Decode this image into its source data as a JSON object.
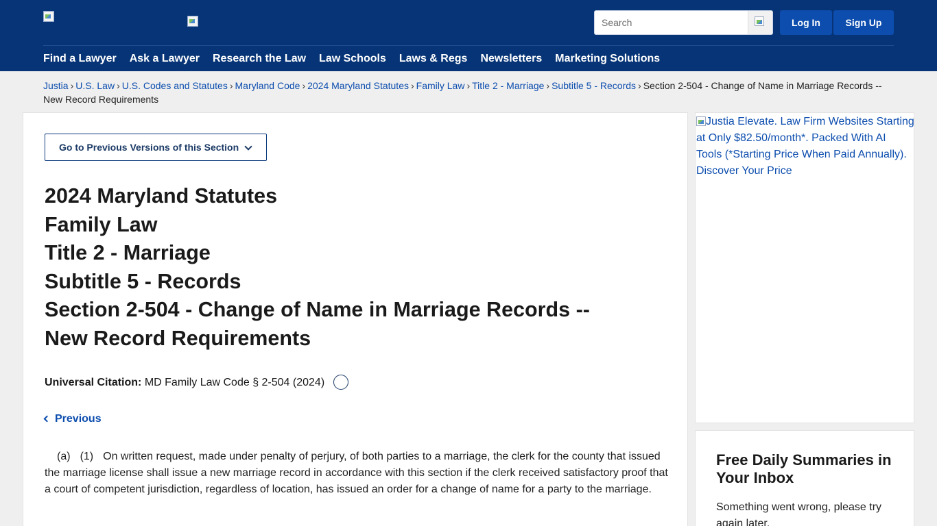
{
  "header": {
    "search_placeholder": "Search",
    "login_label": "Log In",
    "signup_label": "Sign Up",
    "nav": [
      "Find a Lawyer",
      "Ask a Lawyer",
      "Research the Law",
      "Law Schools",
      "Laws & Regs",
      "Newsletters",
      "Marketing Solutions"
    ]
  },
  "breadcrumb": {
    "links": [
      "Justia",
      "U.S. Law",
      "U.S. Codes and Statutes",
      "Maryland Code",
      "2024 Maryland Statutes",
      "Family Law",
      "Title 2 - Marriage",
      "Subtitle 5 - Records"
    ],
    "current": "Section 2-504 - Change of Name in Marriage Records -- New Record Requirements",
    "separator": "›"
  },
  "main": {
    "prev_versions_label": "Go to Previous Versions of this Section",
    "title_lines": [
      "2024 Maryland Statutes",
      "Family Law",
      "Title 2 - Marriage",
      "Subtitle 5 - Records",
      "Section 2-504 - Change of Name in Marriage Records --",
      "New Record Requirements"
    ],
    "citation_label": "Universal Citation:",
    "citation_value": "MD Family Law Code § 2-504 (2024)",
    "previous_label": "Previous",
    "para_a": "(a)",
    "para_1": "(1)",
    "para_text": "On written request, made under penalty of perjury, of both parties to a marriage, the clerk for the county that issued the marriage license shall issue a new marriage record in accordance with this section if the clerk received satisfactory proof that a court of competent jurisdiction, regardless of location, has issued an order for a change of name for a party to the marriage."
  },
  "sidebar": {
    "ad_alt": "Justia Elevate. Law Firm Websites Starting at Only $82.50/month*. Packed With AI Tools (*Starting Price When Paid Annually). Discover Your Price",
    "newsletter_title": "Free Daily Summaries in Your Inbox",
    "newsletter_msg": "Something went wrong, please try again later."
  },
  "colors": {
    "header_bg": "#063476",
    "button_bg": "#0c4dae",
    "link": "#0c4dae"
  }
}
